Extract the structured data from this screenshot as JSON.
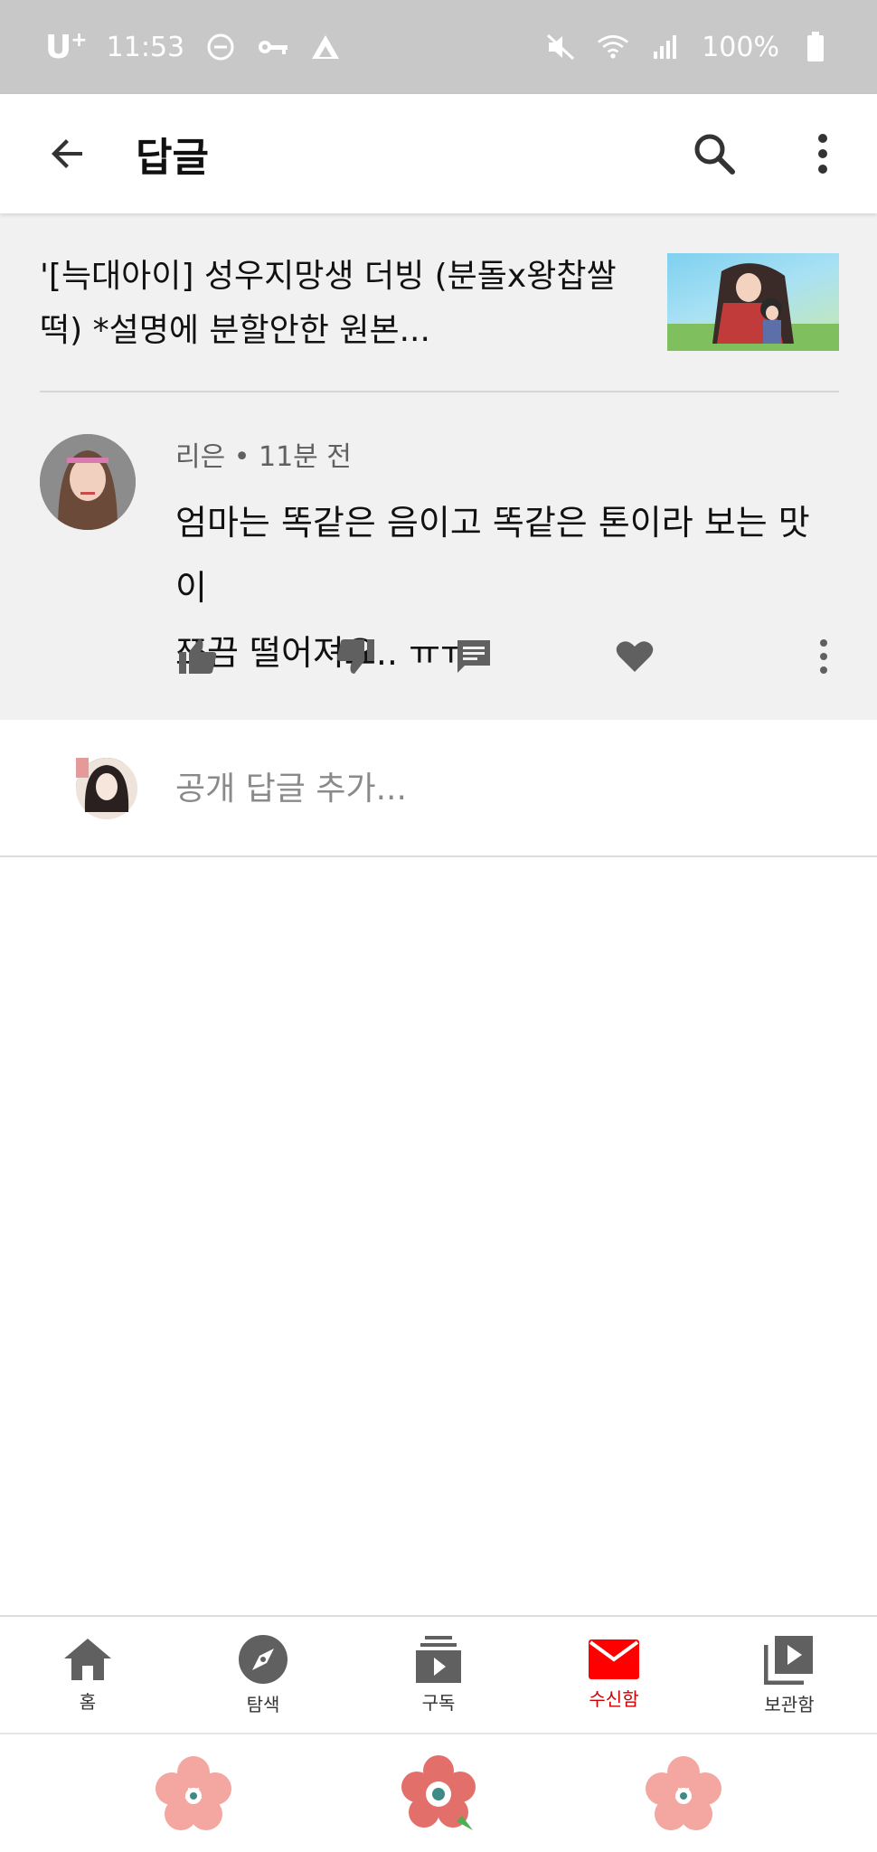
{
  "status_bar": {
    "carrier": "U",
    "carrier_plus": "+",
    "time": "11:53",
    "battery": "100%"
  },
  "app_bar": {
    "title": "답글"
  },
  "video": {
    "title": "'[늑대아이] 성우지망생 더빙 (분돌x왕찹쌀떡) *설명에 분할안한 원본..."
  },
  "comment": {
    "author": "리은",
    "separator": "•",
    "time": "11분 전",
    "text_line1": "엄마는 똑같은 음이고 똑같은 톤이라 보는 맛이",
    "text_line2": "쪼끔 떨어져요.. ㅠㅠ"
  },
  "reply": {
    "placeholder": "공개 답글 추가..."
  },
  "bottom_nav": {
    "items": [
      {
        "label": "홈",
        "icon": "home-icon"
      },
      {
        "label": "탐색",
        "icon": "explore-icon"
      },
      {
        "label": "구독",
        "icon": "subscriptions-icon"
      },
      {
        "label": "수신함",
        "icon": "inbox-icon"
      },
      {
        "label": "보관함",
        "icon": "library-icon"
      }
    ],
    "active_index": 3
  },
  "colors": {
    "accent": "#cc0000",
    "status_bar": "#c8c8c8",
    "thread_bg": "#f1f1f1",
    "icon_gray": "#606060",
    "flower_pink": "#f4a6a0"
  }
}
